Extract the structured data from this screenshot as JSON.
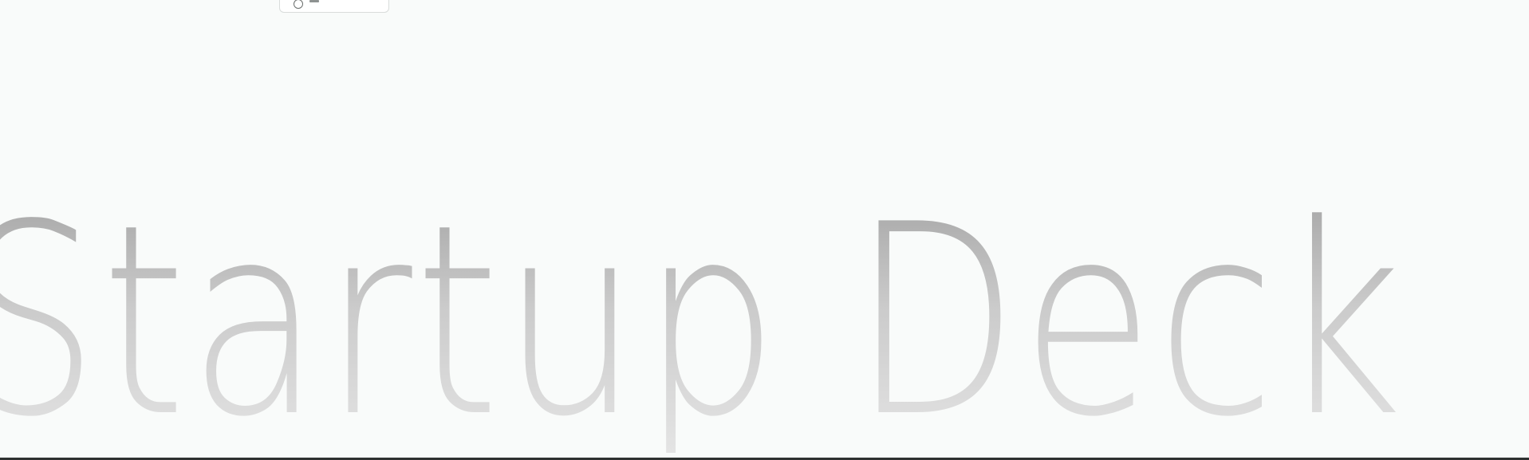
{
  "hero": {
    "title": "Startup Deck"
  },
  "colors": {
    "page_background": "#f9fbfa",
    "title_gradient_top": "#a5a5a5",
    "title_gradient_bottom": "#e4e4e4",
    "bottom_rule": "#2f3231"
  },
  "icons": {
    "top_chip_icon": "circle-icon"
  }
}
